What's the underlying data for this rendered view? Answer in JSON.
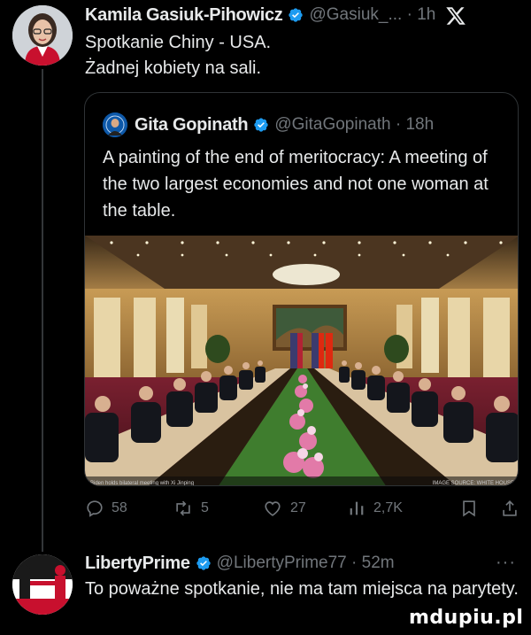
{
  "post1": {
    "author_name": "Kamila Gasiuk-Pihowicz",
    "author_handle": "@Gasiuk_...",
    "time": "1h",
    "text_lines": [
      "Spotkanie Chiny - USA.",
      "Żadnej kobiety na sali."
    ]
  },
  "quoted_post": {
    "author_name": "Gita Gopinath",
    "author_handle": "@GitaGopinath",
    "time": "18h",
    "text": "A painting of the end of meritocracy: A meeting of the two largest economies and not one woman at the table.",
    "image_alt": "Photograph of a long conference table with delegations seated on both sides, flowers down the middle and flags at the far wall",
    "image_caption_left": "Biden holds bilateral meeting with Xi Jinping",
    "image_caption_right": "IMAGE SOURCE: WHITE HOUSE"
  },
  "actions": {
    "replies": "58",
    "reposts": "5",
    "likes": "27",
    "views": "2,7K"
  },
  "post2": {
    "author_name": "LibertyPrime",
    "author_handle": "@LibertyPrime77",
    "time": "52m",
    "text": "To poważne spotkanie, nie ma tam miejsca na parytety."
  },
  "watermark": "mdupiu.pl",
  "colors": {
    "background": "#000000",
    "text": "#e7e9ea",
    "muted": "#71767b",
    "verified": "#1d9bf0",
    "border": "#2f3336"
  },
  "icons": [
    "verified-badge-icon",
    "x-logo-icon",
    "reply-icon",
    "repost-icon",
    "like-icon",
    "views-icon",
    "bookmark-icon",
    "share-icon",
    "more-icon"
  ]
}
